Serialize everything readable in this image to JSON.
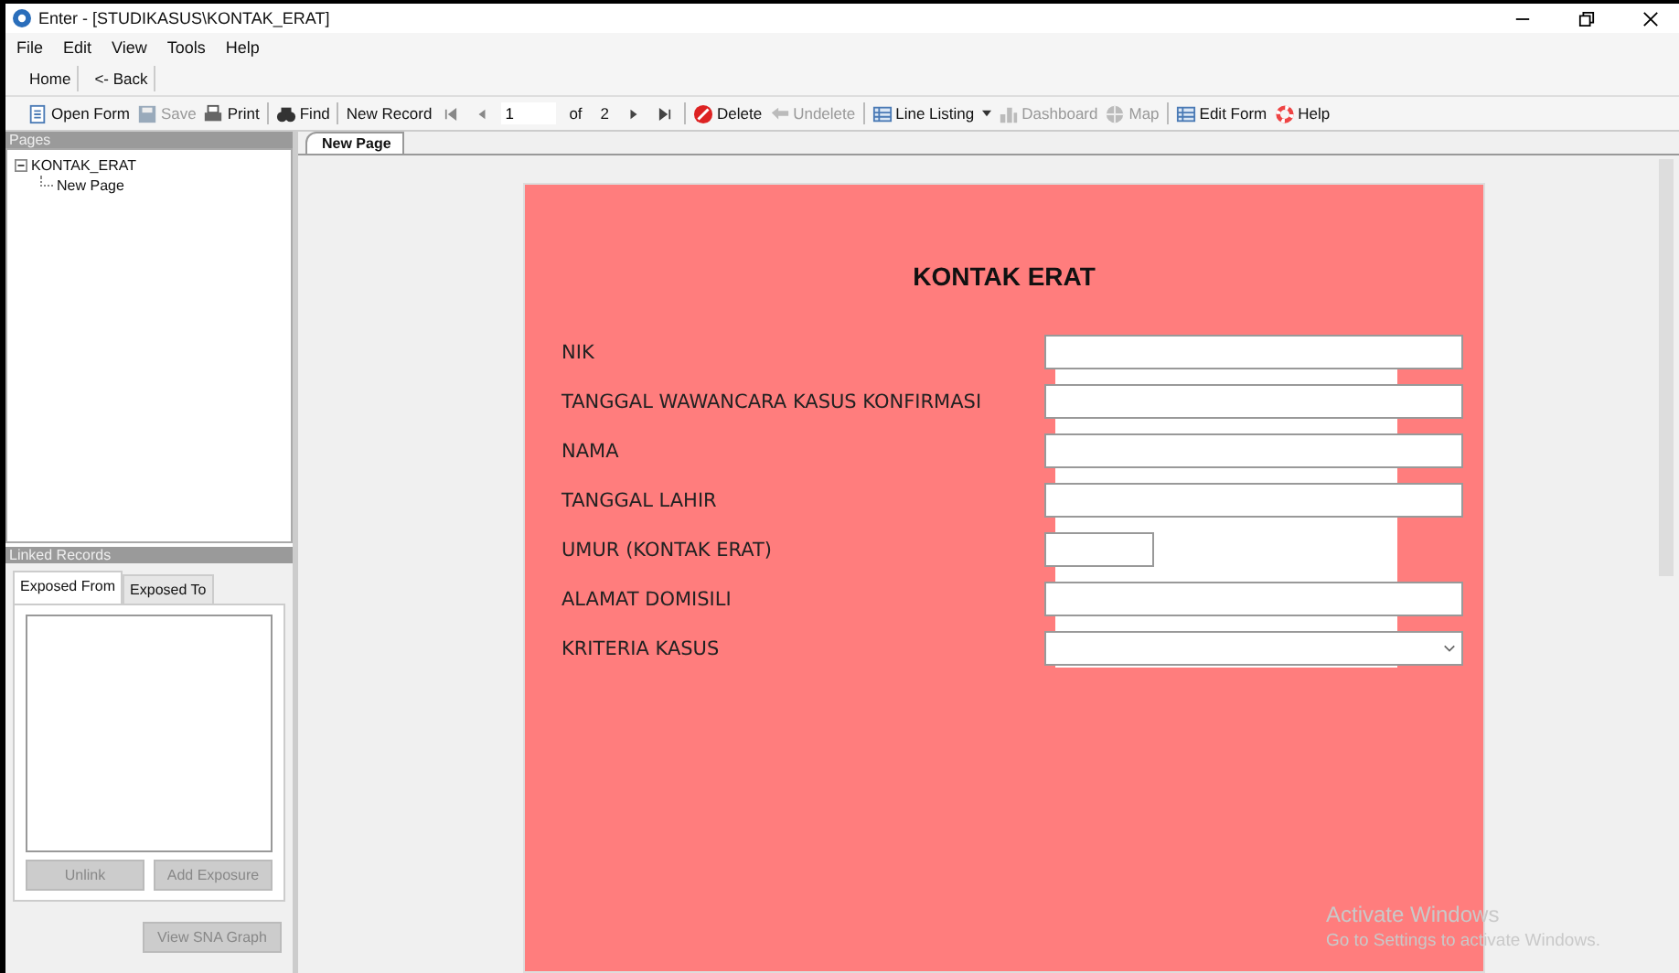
{
  "window": {
    "title": "Enter - [STUDIKASUS\\KONTAK_ERAT]"
  },
  "menu": [
    "File",
    "Edit",
    "View",
    "Tools",
    "Help"
  ],
  "nav_toolbar": [
    {
      "label": "Home"
    },
    {
      "label": "<- Back"
    }
  ],
  "toolbar": [
    {
      "kind": "button",
      "label": "Open Form",
      "disabled": false
    },
    {
      "kind": "button",
      "label": "Save",
      "disabled": true
    },
    {
      "kind": "button",
      "label": "Print",
      "disabled": false
    },
    {
      "kind": "sep"
    },
    {
      "kind": "button",
      "label": "Find",
      "disabled": false
    },
    {
      "kind": "sep"
    },
    {
      "kind": "button",
      "label": "New Record",
      "disabled": false
    },
    {
      "kind": "pager",
      "record": "1",
      "of": "of",
      "total": "2"
    },
    {
      "kind": "sep"
    },
    {
      "kind": "button",
      "label": "Delete",
      "disabled": false
    },
    {
      "kind": "button",
      "label": "Undelete",
      "disabled": true
    },
    {
      "kind": "sep"
    },
    {
      "kind": "button",
      "label": "Line Listing",
      "disabled": false
    },
    {
      "kind": "dropdown"
    },
    {
      "kind": "button",
      "label": "Dashboard",
      "disabled": true
    },
    {
      "kind": "button",
      "label": "Map",
      "disabled": true
    },
    {
      "kind": "sep"
    },
    {
      "kind": "button",
      "label": "Edit Form",
      "disabled": false
    },
    {
      "kind": "button",
      "label": "Help",
      "disabled": false
    }
  ],
  "pages_panel": {
    "title": "Pages",
    "tree": [
      {
        "label": "KONTAK_ERAT",
        "expanded": true,
        "children": [
          {
            "label": "New Page"
          }
        ]
      }
    ]
  },
  "linked_records": {
    "title": "Linked Records",
    "tabs": [
      {
        "label": "Exposed From",
        "selected": true
      },
      {
        "label": "Exposed To",
        "selected": false
      }
    ],
    "buttons": [
      {
        "label": "Unlink",
        "disabled": true
      },
      {
        "label": "Add Exposure",
        "disabled": true
      }
    ],
    "graph_button": {
      "label": "View SNA Graph",
      "disabled": true
    }
  },
  "page_tabs": [
    {
      "label": "New Page",
      "selected": true
    }
  ],
  "form": {
    "title": "KONTAK ERAT",
    "fields": [
      {
        "label": "NIK",
        "kind": "text"
      },
      {
        "label": "TANGGAL WAWANCARA KASUS KONFIRMASI",
        "kind": "text"
      },
      {
        "label": "NAMA",
        "kind": "text"
      },
      {
        "label": "TANGGAL LAHIR",
        "kind": "text"
      },
      {
        "label": "UMUR (KONTAK ERAT)",
        "kind": "short"
      },
      {
        "label": "ALAMAT DOMISILI",
        "kind": "text"
      },
      {
        "label": "KRITERIA KASUS",
        "kind": "select"
      }
    ]
  },
  "os_notice": {
    "title": "Activate Windows",
    "text": "Go to Settings to activate Windows."
  }
}
